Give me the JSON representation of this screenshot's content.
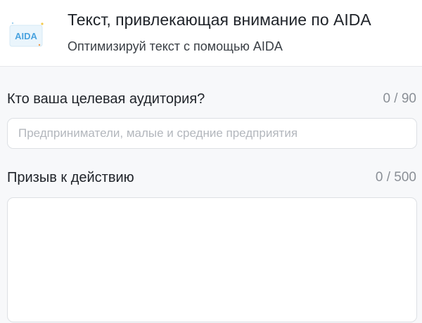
{
  "header": {
    "title": "Текст, привлекающая внимание по AIDA",
    "subtitle": "Оптимизируй текст с помощью AIDA",
    "logo_text": "AIDA",
    "logo_icon": "aida-logo-icon"
  },
  "fields": {
    "audience": {
      "label": "Кто ваша целевая аудитория?",
      "counter": "0 / 90",
      "value": "",
      "placeholder": "Предприниматели, малые и средние предприятия"
    },
    "cta": {
      "label": "Призыв к действию",
      "counter": "0 / 500",
      "value": "",
      "placeholder": ""
    }
  },
  "colors": {
    "logo_accent": "#4aa3df",
    "border": "#dde0e4",
    "counter_text": "#8a8f96",
    "placeholder_text": "#b3b7bd"
  }
}
